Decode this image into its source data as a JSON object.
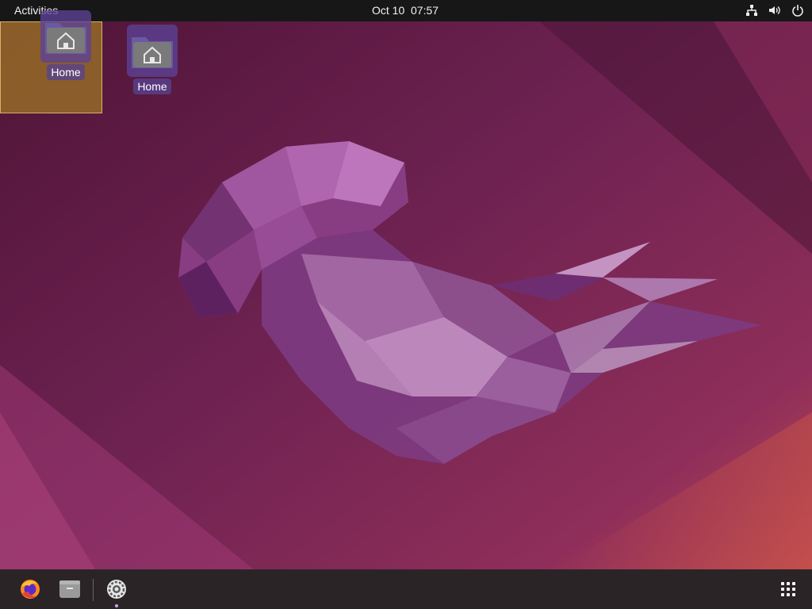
{
  "topbar": {
    "activities": "Activities",
    "clock": "Oct 10  07:57",
    "tray_icons": [
      "network-icon",
      "volume-icon",
      "power-icon"
    ]
  },
  "desktop": {
    "icons": [
      {
        "label": "Home",
        "icon": "home-folder-icon"
      },
      {
        "label": "Home",
        "icon": "home-folder-icon"
      }
    ]
  },
  "dock": {
    "items": [
      {
        "icon": "firefox-icon"
      },
      {
        "icon": "files-icon"
      },
      {
        "icon": "settings-icon",
        "running": true
      }
    ],
    "show_apps_icon": "app-grid-icon"
  },
  "colors": {
    "wallpaper_base": "#5c1d45",
    "accent_purple": "#7a4bc0",
    "topbar": "#171717",
    "dock": "#2a2427"
  }
}
